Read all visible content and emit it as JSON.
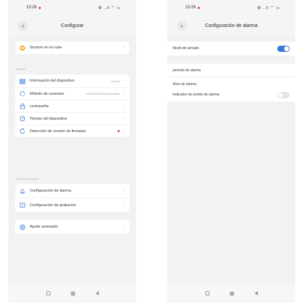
{
  "left": {
    "status": {
      "time": "15:26",
      "icons": "⚙ ..ıl ⌔ ▭"
    },
    "title": "Configurar",
    "cloud": {
      "label": "Servicio en la nube"
    },
    "section1": {
      "label": "ajustes"
    },
    "items1": [
      {
        "label": "Información del dispositivo",
        "value": "Puerta"
      },
      {
        "label": "Método de conexión",
        "value": "WIRGZERBALIM/inmalado"
      },
      {
        "label": "contraseña",
        "value": ""
      },
      {
        "label": "Tiempo del dispositivo",
        "value": ""
      },
      {
        "label": "Detección de versión de firmware",
        "value": ""
      }
    ],
    "section2": {
      "label": "Operar de función"
    },
    "items2": [
      {
        "label": "Configuración de alarma"
      },
      {
        "label": "Configuración de grabación"
      }
    ],
    "advanced": {
      "label": "Ajuste avanzado"
    }
  },
  "right": {
    "status": {
      "time": "15:26",
      "icons": "⚙ ..ıl ⌔ ▭"
    },
    "title": "Configuración de alarma",
    "arming": {
      "label": "Modo de armado",
      "on": true
    },
    "items": [
      {
        "label": "periodo de alarma"
      },
      {
        "label": "Área de alarma"
      }
    ],
    "sound": {
      "label": "Indicador de sonido de alarma",
      "on": false
    }
  },
  "colors": {
    "accent": "#3a7bd5",
    "cloud_icon": "#f5a623",
    "alert_dot": "#e53935"
  }
}
